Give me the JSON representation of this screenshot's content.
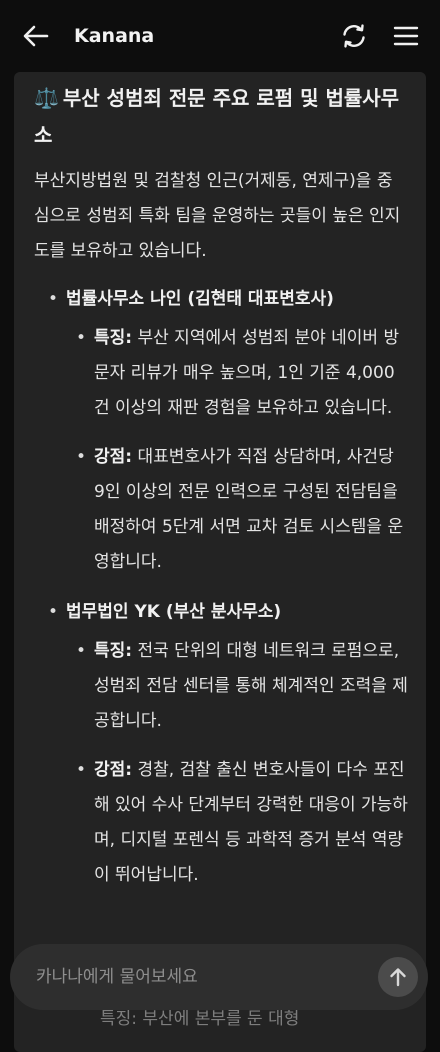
{
  "header": {
    "title": "Kanana"
  },
  "message": {
    "heading_emoji": "⚖️",
    "heading": "부산 성범죄 전문 주요 로펌 및 법률사무소",
    "intro": "부산지방법원 및 검찰청 인근(거제동, 연제구)을 중심으로 성범죄 특화 팀을 운영하는 곳들이 높은 인지도를 보유하고 있습니다.",
    "firms": [
      {
        "name": "법률사무소 나인 (김현태 대표변호사)",
        "details": [
          {
            "label": "특징:",
            "text": " 부산 지역에서 성범죄 분야 네이버 방문자 리뷰가 매우 높으며, 1인 기준 4,000건 이상의 재판 경험을 보유하고 있습니다."
          },
          {
            "label": "강점:",
            "text": " 대표변호사가 직접 상담하며, 사건당 9인 이상의 전문 인력으로 구성된 전담팀을 배정하여 5단계 서면 교차 검토 시스템을 운영합니다."
          }
        ]
      },
      {
        "name": "법무법인 YK (부산 분사무소)",
        "details": [
          {
            "label": "특징:",
            "text": " 전국 단위의 대형 네트워크 로펌으로, 성범죄 전담 센터를 통해 체계적인 조력을 제공합니다."
          },
          {
            "label": "강점:",
            "text": " 경찰, 검찰 출신 변호사들이 다수 포진해 있어 수사 단계부터 강력한 대응이 가능하며, 디지털 포렌식 등 과학적 증거 분석 역량이 뛰어납니다."
          }
        ]
      }
    ],
    "peek_text": "특징: 부산에 본부를 둔 대형"
  },
  "input": {
    "placeholder": "카나나에게 물어보세요"
  },
  "icons": {
    "back": "arrow-left-icon",
    "refresh": "refresh-icon",
    "menu": "hamburger-menu-icon",
    "send": "arrow-up-icon"
  }
}
